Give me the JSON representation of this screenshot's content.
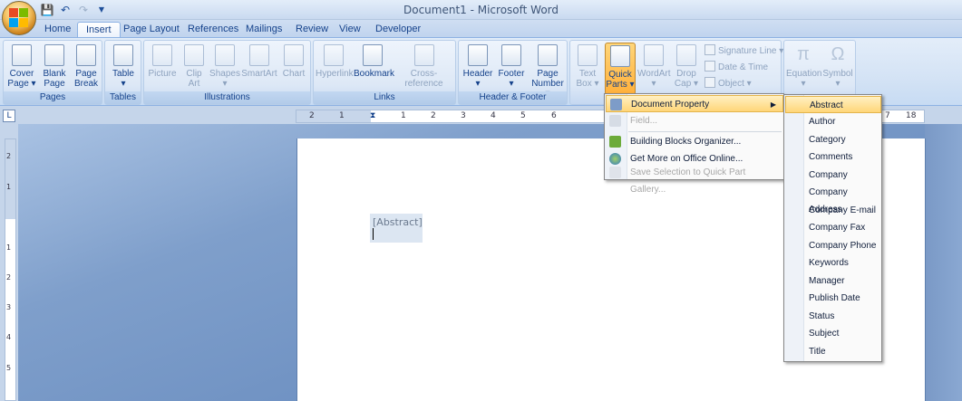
{
  "window": {
    "title": "Document1 - Microsoft Word"
  },
  "tabs": [
    "Home",
    "Insert",
    "Page Layout",
    "References",
    "Mailings",
    "Review",
    "View",
    "Developer"
  ],
  "active_tab": "Insert",
  "groups": {
    "pages": {
      "label": "Pages",
      "buttons": [
        "Cover Page",
        "Blank Page",
        "Page Break"
      ]
    },
    "tables": {
      "label": "Tables",
      "buttons": [
        "Table"
      ]
    },
    "illustrations": {
      "label": "Illustrations",
      "buttons": [
        "Picture",
        "Clip Art",
        "Shapes",
        "SmartArt",
        "Chart"
      ]
    },
    "links": {
      "label": "Links",
      "buttons": [
        "Hyperlink",
        "Bookmark",
        "Cross-reference"
      ]
    },
    "header_footer": {
      "label": "Header & Footer",
      "buttons": [
        "Header",
        "Footer",
        "Page Number"
      ]
    },
    "text": {
      "buttons": [
        "Text Box",
        "Quick Parts",
        "WordArt",
        "Drop Cap"
      ],
      "small": [
        "Signature Line",
        "Date & Time",
        "Object"
      ]
    },
    "symbols": {
      "buttons": [
        "Equation",
        "Symbol"
      ]
    }
  },
  "btn_lines": {
    "cover": [
      "Cover",
      "Page"
    ],
    "blank": [
      "Blank",
      "Page"
    ],
    "break": [
      "Page",
      "Break"
    ],
    "table": [
      "Table",
      ""
    ],
    "picture": [
      "Picture",
      ""
    ],
    "clipart": [
      "Clip",
      "Art"
    ],
    "shapes": [
      "Shapes",
      ""
    ],
    "smartart": [
      "SmartArt",
      ""
    ],
    "chart": [
      "Chart",
      ""
    ],
    "hyperlink": [
      "Hyperlink",
      ""
    ],
    "bookmark": [
      "Bookmark",
      ""
    ],
    "crossref": [
      "Cross-reference",
      ""
    ],
    "header": [
      "Header",
      ""
    ],
    "footer": [
      "Footer",
      ""
    ],
    "pagenum": [
      "Page",
      "Number"
    ],
    "textbox": [
      "Text",
      "Box"
    ],
    "quickparts": [
      "Quick",
      "Parts"
    ],
    "wordart": [
      "WordArt",
      ""
    ],
    "dropcap": [
      "Drop",
      "Cap"
    ],
    "equation": [
      "Equation",
      ""
    ],
    "symbol": [
      "Symbol",
      ""
    ]
  },
  "ruler_labels": [
    "2",
    "1",
    "1",
    "2",
    "3",
    "4",
    "5",
    "6",
    "7",
    "18"
  ],
  "vruler_labels": [
    "2",
    "1",
    "1",
    "2",
    "3",
    "4",
    "5"
  ],
  "document": {
    "content_control": "[Abstract]"
  },
  "quick_parts_menu": {
    "items": [
      {
        "label": "Document Property",
        "state": "highlighted",
        "submenu": true
      },
      {
        "label": "Field...",
        "state": "disabled"
      },
      {
        "label": "Building Blocks Organizer...",
        "state": "normal"
      },
      {
        "label": "Get More on Office Online...",
        "state": "normal"
      },
      {
        "label": "Save Selection to Quick Part Gallery...",
        "state": "disabled"
      }
    ]
  },
  "document_property_submenu": {
    "items": [
      "Abstract",
      "Author",
      "Category",
      "Comments",
      "Company",
      "Company Address",
      "Company E-mail",
      "Company Fax",
      "Company Phone",
      "Keywords",
      "Manager",
      "Publish Date",
      "Status",
      "Subject",
      "Title"
    ],
    "highlighted": "Abstract"
  },
  "colors": {
    "accent_highlight": "#ffd679",
    "ribbon_text": "#15428b",
    "doc_background": "#7f9fcb"
  }
}
